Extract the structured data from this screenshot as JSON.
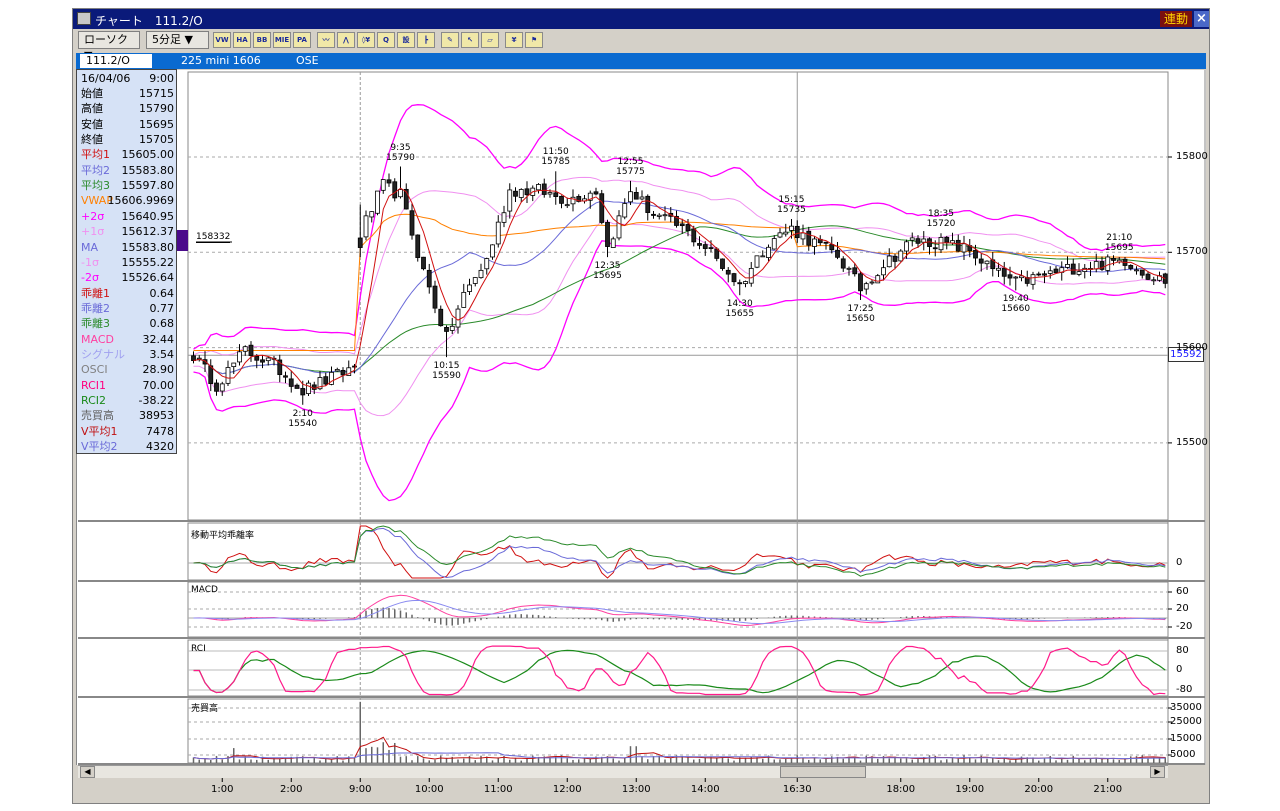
{
  "window": {
    "title": "チャート　111.2/O",
    "link_label": "連動",
    "close_icon": "close-icon"
  },
  "toolbar": {
    "chart_type": "ローソク ▼",
    "interval": "5分足 ▼",
    "icons": [
      {
        "name": "vwap-icon",
        "label": "VW"
      },
      {
        "name": "ha-icon",
        "label": "HA"
      },
      {
        "name": "bb-icon",
        "label": "BB"
      },
      {
        "name": "mie-icon",
        "label": "MIE"
      },
      {
        "name": "pa-icon",
        "label": "PA"
      },
      {
        "name": "indicator-icon",
        "label": "〰"
      },
      {
        "name": "trend-icon",
        "label": "⋀"
      },
      {
        "name": "yen-icon",
        "label": "◊¥"
      },
      {
        "name": "zoom-icon",
        "label": "Q"
      },
      {
        "name": "settings-icon",
        "label": "設"
      },
      {
        "name": "layout-icon",
        "label": "┣"
      },
      {
        "name": "pencil-icon",
        "label": "✎"
      },
      {
        "name": "cursor-icon",
        "label": "↖"
      },
      {
        "name": "eraser-icon",
        "label": "▱"
      },
      {
        "name": "coin-icon",
        "label": "¥"
      },
      {
        "name": "flag-icon",
        "label": "⚑"
      }
    ]
  },
  "symbol": {
    "code": "111.2/O",
    "name": "225 mini 1606",
    "exchange": "OSE"
  },
  "info": {
    "date": "16/04/06",
    "time": "9:00",
    "rows": [
      {
        "label": "始値",
        "value": "15715",
        "color": "#000000"
      },
      {
        "label": "高値",
        "value": "15790",
        "color": "#000000"
      },
      {
        "label": "安値",
        "value": "15695",
        "color": "#000000"
      },
      {
        "label": "終値",
        "value": "15705",
        "color": "#000000"
      },
      {
        "label": "平均1",
        "value": "15605.00",
        "color": "#d01010"
      },
      {
        "label": "平均2",
        "value": "15583.80",
        "color": "#6a6ad8"
      },
      {
        "label": "平均3",
        "value": "15597.80",
        "color": "#2a8a2a"
      },
      {
        "label": "VWAP",
        "value": "15606.9969",
        "color": "#ff8000"
      },
      {
        "label": "+2σ",
        "value": "15640.95",
        "color": "#ff00ff"
      },
      {
        "label": "+1σ",
        "value": "15612.37",
        "color": "#f090f0"
      },
      {
        "label": "MA",
        "value": "15583.80",
        "color": "#6a6ad8"
      },
      {
        "label": "-1σ",
        "value": "15555.22",
        "color": "#f090f0"
      },
      {
        "label": "-2σ",
        "value": "15526.64",
        "color": "#ff00ff"
      },
      {
        "label": "乖離1",
        "value": "0.64",
        "color": "#d01010"
      },
      {
        "label": "乖離2",
        "value": "0.77",
        "color": "#6a6ad8"
      },
      {
        "label": "乖離3",
        "value": "0.68",
        "color": "#2a8a2a"
      },
      {
        "label": "MACD",
        "value": "32.44",
        "color": "#ff40a0"
      },
      {
        "label": "シグナル",
        "value": "3.54",
        "color": "#a0a0f0"
      },
      {
        "label": "OSCI",
        "value": "28.90",
        "color": "#808080"
      },
      {
        "label": "RCI1",
        "value": "70.00",
        "color": "#ff0080"
      },
      {
        "label": "RCI2",
        "value": "-38.22",
        "color": "#1a8a1a"
      },
      {
        "label": "売買高",
        "value": "38953",
        "color": "#606060"
      },
      {
        "label": "V平均1",
        "value": "7478",
        "color": "#c01010"
      },
      {
        "label": "V平均2",
        "value": "4320",
        "color": "#6a6ad8"
      }
    ]
  },
  "marker_label": "158332",
  "current_price": "15592",
  "panes": {
    "deviation": "移動平均乖離率",
    "macd": "MACD",
    "rci": "RCI",
    "volume": "売買高"
  },
  "chart_data": {
    "type": "candlestick",
    "x_ticks": [
      "1:00",
      "2:00",
      "9:00",
      "10:00",
      "11:00",
      "12:00",
      "13:00",
      "14:00",
      "16:30",
      "18:00",
      "19:00",
      "20:00",
      "21:00"
    ],
    "price_ticks": [
      "15800",
      "15700",
      "15600",
      "15500"
    ],
    "deviation_ticks": [
      "0"
    ],
    "macd_ticks": [
      "60",
      "20",
      "-20"
    ],
    "rci_ticks": [
      "80",
      "0",
      "-80"
    ],
    "volume_ticks": [
      "35000",
      "25000",
      "15000",
      "5000"
    ],
    "close_anchors": [
      [
        0,
        15592
      ],
      [
        4,
        15561
      ],
      [
        9,
        15597
      ],
      [
        14,
        15582
      ],
      [
        19,
        15555
      ],
      [
        24,
        15568
      ],
      [
        28,
        15580
      ],
      [
        29,
        15720
      ],
      [
        33,
        15770
      ],
      [
        36,
        15760
      ],
      [
        40,
        15680
      ],
      [
        44,
        15610
      ],
      [
        47,
        15655
      ],
      [
        51,
        15692
      ],
      [
        55,
        15765
      ],
      [
        60,
        15765
      ],
      [
        65,
        15755
      ],
      [
        70,
        15765
      ],
      [
        72,
        15705
      ],
      [
        76,
        15765
      ],
      [
        80,
        15740
      ],
      [
        85,
        15725
      ],
      [
        90,
        15700
      ],
      [
        95,
        15665
      ],
      [
        100,
        15712
      ],
      [
        104,
        15725
      ],
      [
        108,
        15710
      ],
      [
        112,
        15697
      ],
      [
        116,
        15662
      ],
      [
        120,
        15687
      ],
      [
        125,
        15712
      ],
      [
        130,
        15710
      ],
      [
        135,
        15702
      ],
      [
        139,
        15681
      ],
      [
        143,
        15668
      ],
      [
        148,
        15676
      ],
      [
        153,
        15684
      ],
      [
        158,
        15688
      ],
      [
        162,
        15692
      ],
      [
        166,
        15677
      ],
      [
        169,
        15670
      ]
    ],
    "annotations": [
      {
        "time": "2:10",
        "price": "15540",
        "type": "low"
      },
      {
        "time": "9:35",
        "price": "15790",
        "type": "high"
      },
      {
        "time": "10:15",
        "price": "15590",
        "type": "low"
      },
      {
        "time": "11:50",
        "price": "15785",
        "type": "high"
      },
      {
        "time": "12:35",
        "price": "15695",
        "type": "low"
      },
      {
        "time": "12:55",
        "price": "15775",
        "type": "high"
      },
      {
        "time": "14:30",
        "price": "15655",
        "type": "low"
      },
      {
        "time": "15:15",
        "price": "15735",
        "type": "high"
      },
      {
        "time": "17:25",
        "price": "15650",
        "type": "low"
      },
      {
        "time": "18:35",
        "price": "15720",
        "type": "high"
      },
      {
        "time": "19:40",
        "price": "15660",
        "type": "low"
      },
      {
        "time": "21:10",
        "price": "15695",
        "type": "high"
      }
    ],
    "colors": {
      "ma1": "#d01010",
      "ma2": "#6a6ad8",
      "ma3": "#2a8a2a",
      "vwap": "#ff8000",
      "bb2": "#ff00ff",
      "bb1": "#f090f0",
      "macd": "#ff40a0",
      "signal": "#8a8af0",
      "rci1": "#ff1a8a",
      "rci2": "#1a8a1a"
    }
  }
}
